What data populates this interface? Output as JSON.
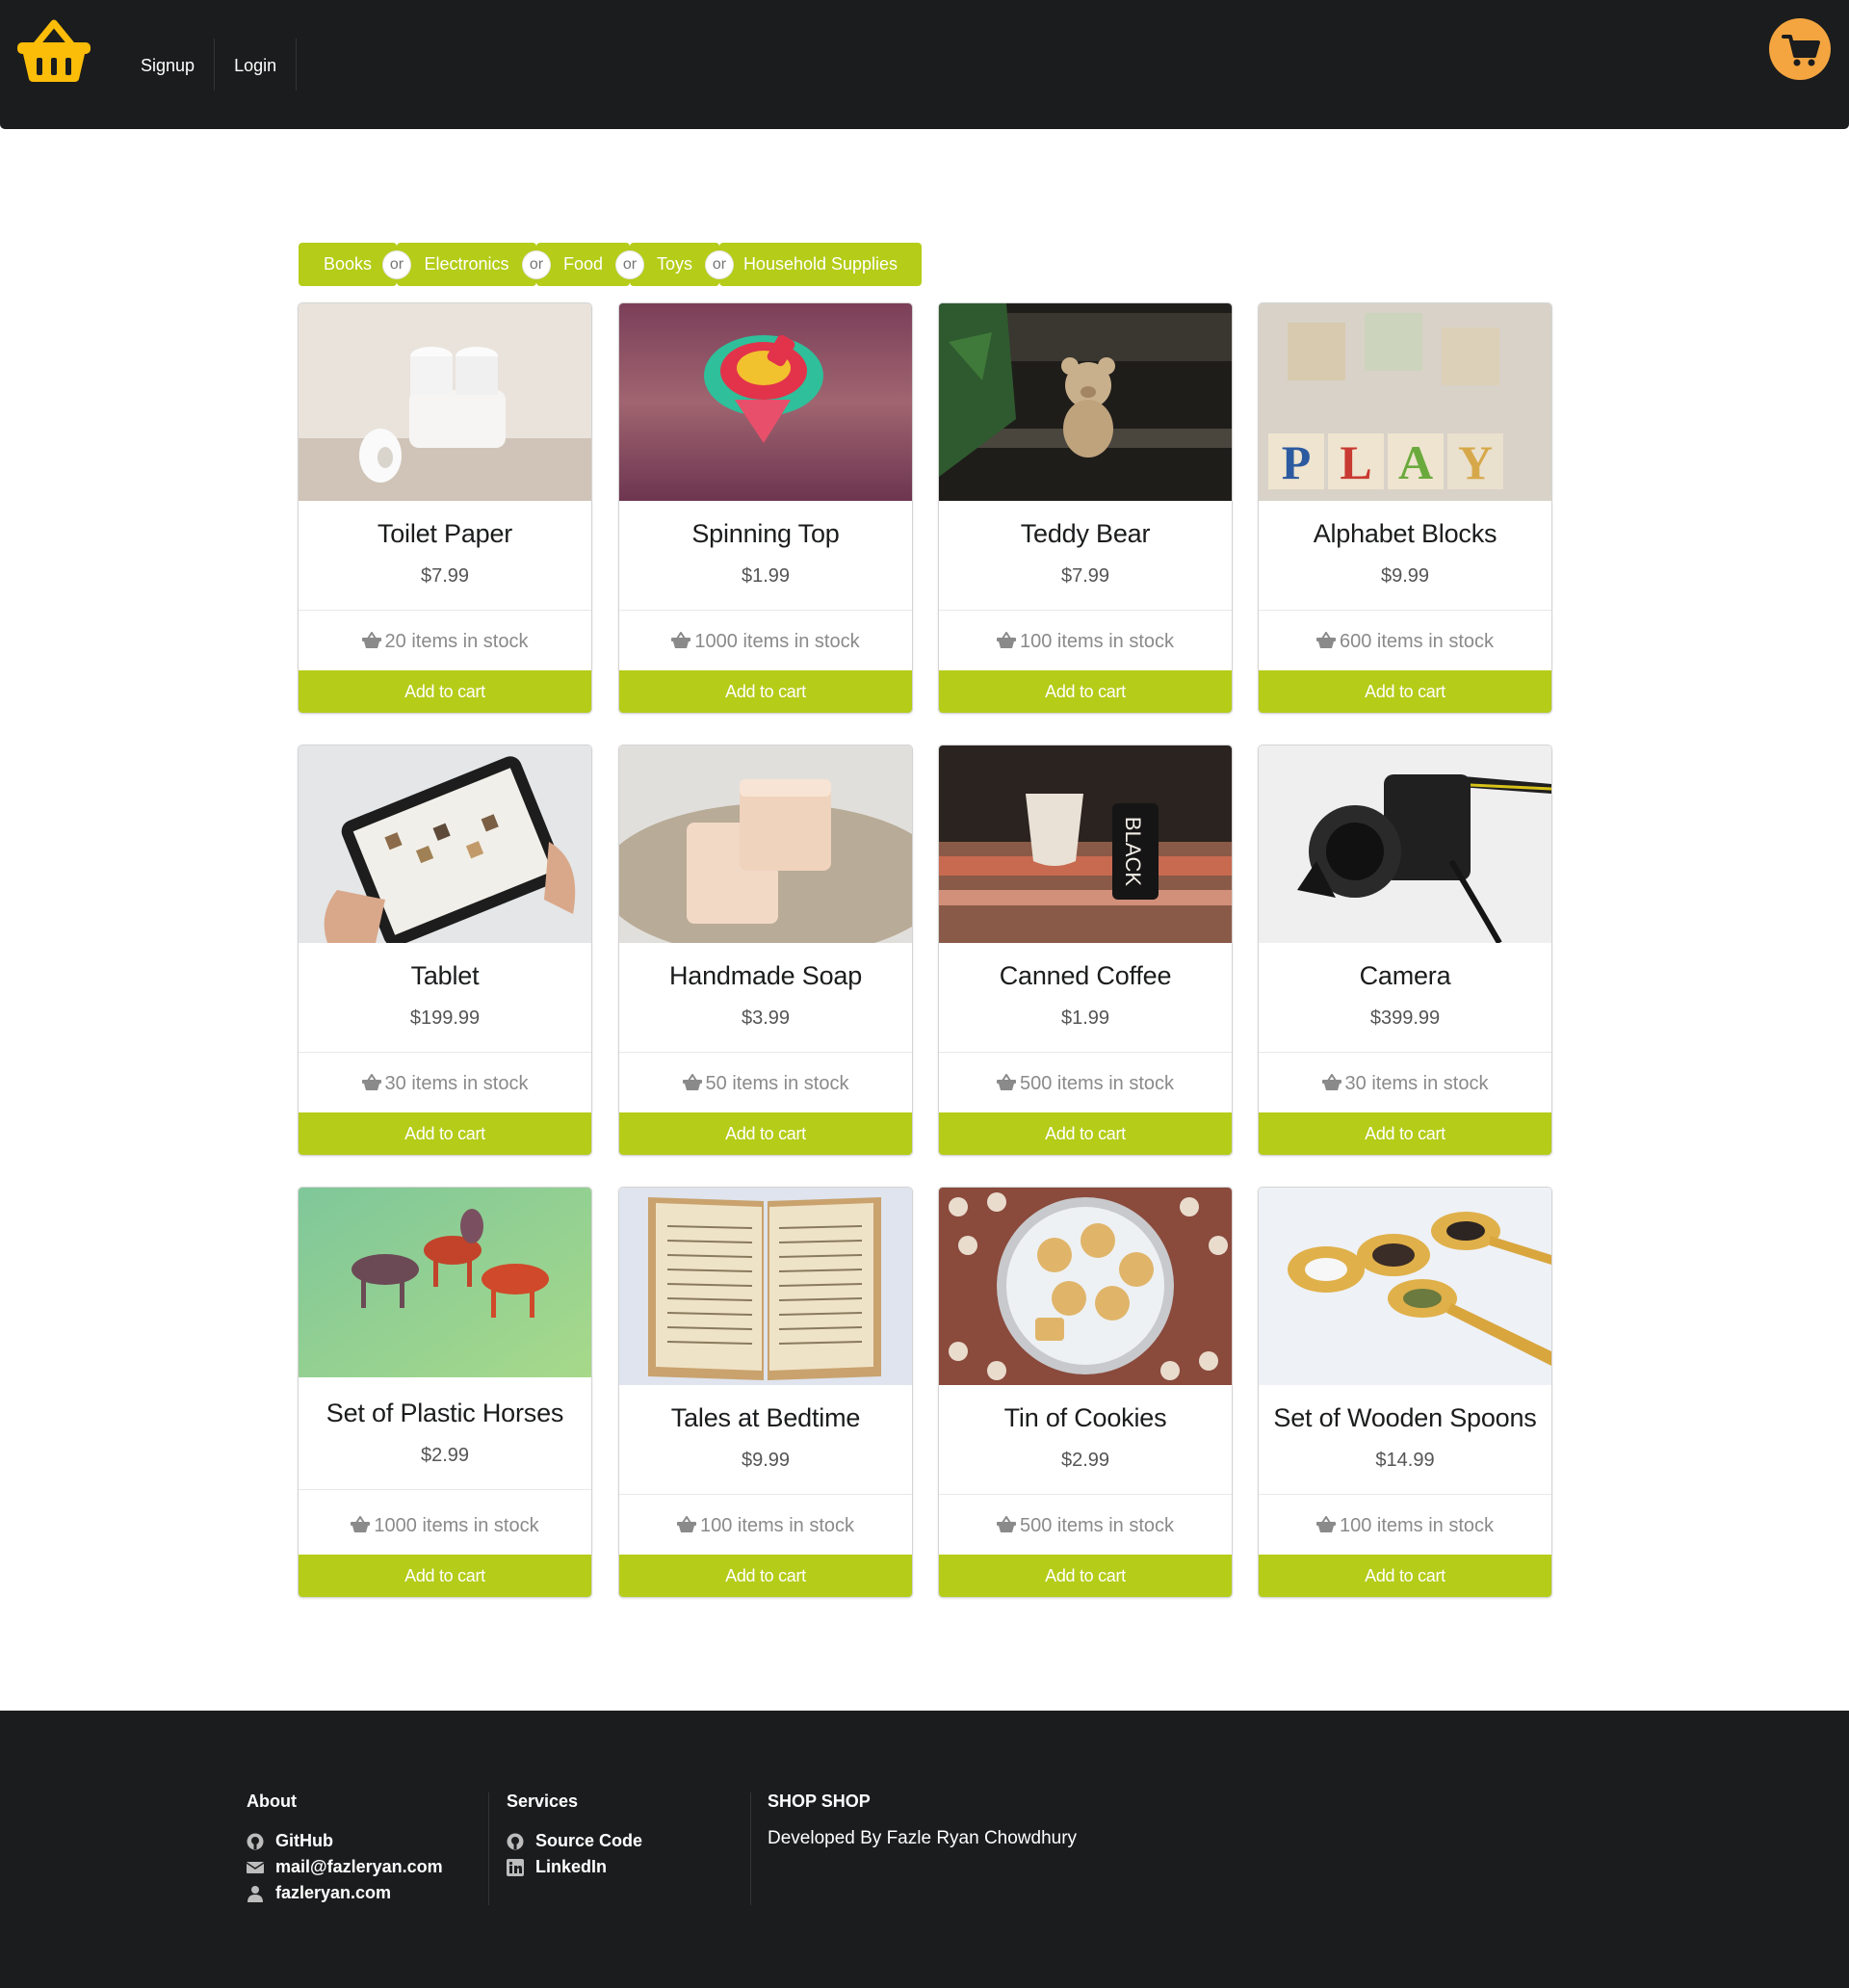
{
  "header": {
    "logo_icon": "shopping-basket-icon",
    "nav": [
      {
        "label": "Signup"
      },
      {
        "label": "Login"
      }
    ],
    "cart_icon": "cart-icon",
    "cart_color": "#f4a540"
  },
  "categories": {
    "items": [
      "Books",
      "Electronics",
      "Food",
      "Toys",
      "Household Supplies"
    ],
    "separator": "or",
    "color": "#b5cc18"
  },
  "products": [
    {
      "name": "Toilet Paper",
      "price": "$7.99",
      "stock": "20 items in stock",
      "button": "Add to cart"
    },
    {
      "name": "Spinning Top",
      "price": "$1.99",
      "stock": "1000 items in stock",
      "button": "Add to cart"
    },
    {
      "name": "Teddy Bear",
      "price": "$7.99",
      "stock": "100 items in stock",
      "button": "Add to cart"
    },
    {
      "name": "Alphabet Blocks",
      "price": "$9.99",
      "stock": "600 items in stock",
      "button": "Add to cart"
    },
    {
      "name": "Tablet",
      "price": "$199.99",
      "stock": "30 items in stock",
      "button": "Add to cart"
    },
    {
      "name": "Handmade Soap",
      "price": "$3.99",
      "stock": "50 items in stock",
      "button": "Add to cart"
    },
    {
      "name": "Canned Coffee",
      "price": "$1.99",
      "stock": "500 items in stock",
      "button": "Add to cart"
    },
    {
      "name": "Camera",
      "price": "$399.99",
      "stock": "30 items in stock",
      "button": "Add to cart"
    },
    {
      "name": "Set of Plastic Horses",
      "price": "$2.99",
      "stock": "1000 items in stock",
      "button": "Add to cart"
    },
    {
      "name": "Tales at Bedtime",
      "price": "$9.99",
      "stock": "100 items in stock",
      "button": "Add to cart"
    },
    {
      "name": "Tin of Cookies",
      "price": "$2.99",
      "stock": "500 items in stock",
      "button": "Add to cart"
    },
    {
      "name": "Set of Wooden Spoons",
      "price": "$14.99",
      "stock": "100 items in stock",
      "button": "Add to cart"
    }
  ],
  "footer": {
    "about": {
      "title": "About",
      "links": [
        {
          "icon": "github-icon",
          "label": "GitHub"
        },
        {
          "icon": "mail-icon",
          "label": "mail@fazleryan.com"
        },
        {
          "icon": "user-icon",
          "label": "fazleryan.com"
        }
      ]
    },
    "services": {
      "title": "Services",
      "links": [
        {
          "icon": "github-icon",
          "label": "Source Code"
        },
        {
          "icon": "linkedin-icon",
          "label": "LinkedIn"
        }
      ]
    },
    "brand": {
      "title": "SHOP SHOP",
      "text": "Developed By Fazle Ryan Chowdhury"
    }
  }
}
